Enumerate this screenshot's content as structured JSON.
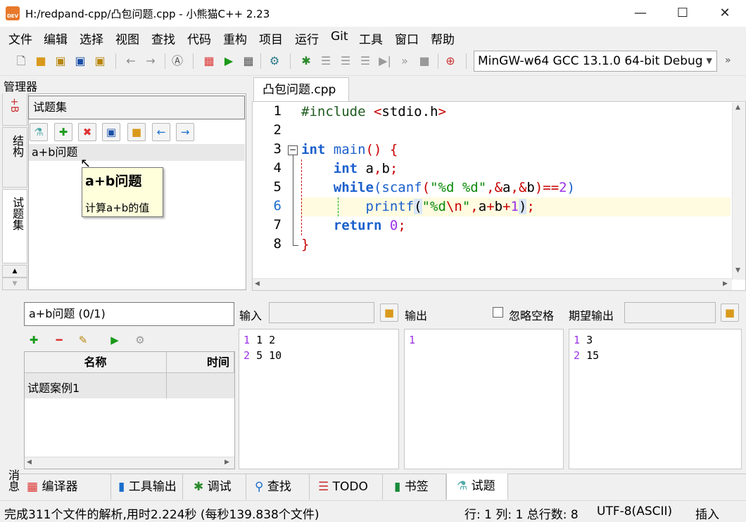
{
  "window": {
    "title": "H:/redpand-cpp/凸包问题.cpp - 小熊猫C++ 2.23",
    "icon_text": "DEV",
    "minimize": "—",
    "maximize": "☐",
    "close": "✕"
  },
  "menu": [
    "文件",
    "编辑",
    "选择",
    "视图",
    "查找",
    "代码",
    "重构",
    "项目",
    "运行",
    "Git",
    "工具",
    "窗口",
    "帮助"
  ],
  "toolbar": {
    "compiler": "MinGW-w64 GCC 13.1.0 64-bit Debug",
    "icons": [
      "new-file-icon",
      "open-icon",
      "save-icon",
      "save-as-icon",
      "save-all-icon",
      "undo-icon",
      "redo-icon",
      "format-icon",
      "compile-icon",
      "run-icon",
      "compile-run-icon",
      "rebuild-icon",
      "debug-icon",
      "step-over-icon",
      "step-into-icon",
      "step-out-icon",
      "continue-icon",
      "stop-icon",
      "add-watch-icon"
    ]
  },
  "manager": {
    "label": "管理器",
    "vtabs": [
      "项目",
      "结构",
      "试题集"
    ],
    "problemset_title": "试题集",
    "problems": [
      "a+b问题"
    ],
    "tooltip": {
      "title": "a+b问题",
      "body": "计算a+b的值"
    }
  },
  "editor": {
    "tab_label": "凸包问题.cpp",
    "tab_close": "✕",
    "line_numbers": [
      "1",
      "2",
      "3",
      "4",
      "5",
      "6",
      "7",
      "8"
    ],
    "code_plain": [
      "#include <stdio.h>",
      "",
      "int main() {",
      "    int a,b;",
      "    while(scanf(\"%d %d\",&a,&b)==2)",
      "        printf(\"%d\\n\",a+b+1);",
      "    return 0;",
      "}"
    ],
    "current_line": 6
  },
  "tests": {
    "case_title": "a+b问题 (0/1)",
    "columns": [
      "名称",
      "时间"
    ],
    "rows": [
      "试题案例1"
    ],
    "input_label": "输入",
    "output_label": "输出",
    "ignore_spaces_label": "忽略空格",
    "expected_label": "期望输出",
    "input_lines": [
      {
        "n": "1",
        "t": "1 2"
      },
      {
        "n": "2",
        "t": "5 10"
      }
    ],
    "output_lines": [
      {
        "n": "1",
        "t": ""
      }
    ],
    "expected_lines": [
      {
        "n": "1",
        "t": "3"
      },
      {
        "n": "2",
        "t": "15"
      }
    ]
  },
  "bottom_tabs": [
    "编译器",
    "工具输出",
    "调试",
    "查找",
    "TODO",
    "书签",
    "试题"
  ],
  "messages_vlabel": "消息",
  "status": {
    "parse": "完成311个文件的解析,用时2.224秒 (每秒139.838个文件)",
    "position": "行: 1 列: 1 总行数: 8",
    "encoding": "UTF-8(ASCII)",
    "mode": "插入"
  }
}
